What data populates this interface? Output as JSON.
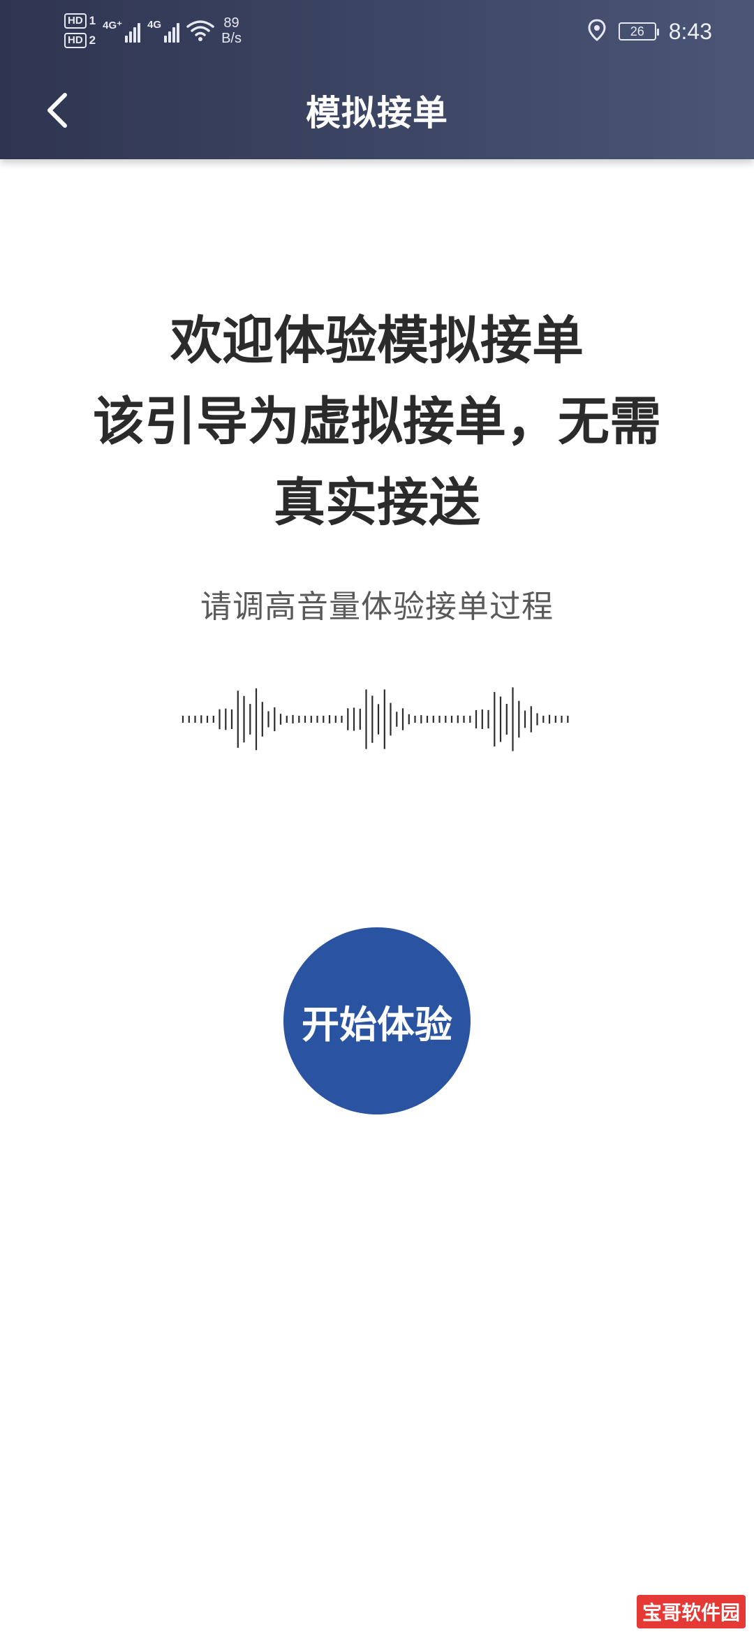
{
  "status_bar": {
    "hd1": "HD",
    "hd1_sub": "1",
    "hd2": "HD",
    "hd2_sub": "2",
    "net1": "4G⁺",
    "net2": "4G",
    "speed_value": "89",
    "speed_unit": "B/s",
    "battery": "26",
    "time": "8:43"
  },
  "header": {
    "title": "模拟接单"
  },
  "main": {
    "headline_lines": [
      "欢迎体验模拟接单",
      "该引导为虚拟接单，无需",
      "真实接送"
    ],
    "subtext": "请调高音量体验接单过程",
    "start_button": "开始体验"
  },
  "watermark": "宝哥软件园",
  "colors": {
    "header_start": "#2f3550",
    "header_end": "#4b5575",
    "button": "#2a54a1",
    "text": "#2b2b2b"
  }
}
